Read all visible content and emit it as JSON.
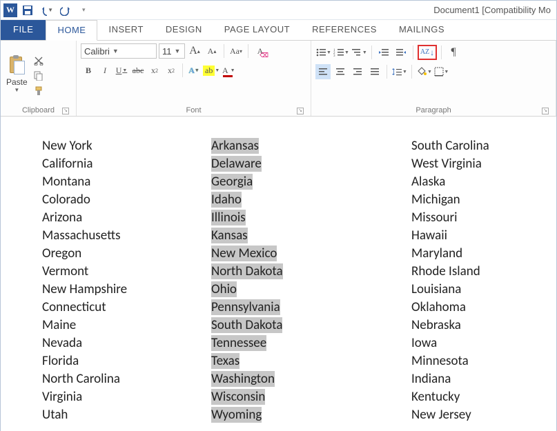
{
  "title": "Document1 [Compatibility Mo",
  "app_icon_letter": "W",
  "qat": {
    "save": "save-icon",
    "undo": "undo-icon",
    "redo": "redo-icon"
  },
  "tabs": {
    "file": "FILE",
    "home": "HOME",
    "insert": "INSERT",
    "design": "DESIGN",
    "page_layout": "PAGE LAYOUT",
    "references": "REFERENCES",
    "mailings": "MAILINGS"
  },
  "clipboard": {
    "label": "Clipboard",
    "paste": "Paste"
  },
  "font": {
    "label": "Font",
    "name": "Calibri",
    "size": "11",
    "bold": "B",
    "italic": "I",
    "underline": "U",
    "strike": "abc",
    "sub": "x",
    "sup": "x",
    "caseA": "A",
    "caseAa": "Aa",
    "clear": "A",
    "grow": "A",
    "shrink": "A",
    "highlight": "ab",
    "color": "A"
  },
  "paragraph": {
    "label": "Paragraph",
    "sortA": "A",
    "sortZ": "Z",
    "pilcrow": "¶"
  },
  "doc": {
    "col1": [
      "New York",
      "California",
      "Montana",
      "Colorado",
      "Arizona",
      "Massachusetts",
      "Oregon",
      "Vermont",
      "New Hampshire",
      "Connecticut",
      "Maine",
      "Nevada",
      "Florida",
      "North Carolina",
      "Virginia",
      "Utah"
    ],
    "col2": [
      "Arkansas",
      "Delaware",
      "Georgia",
      "Idaho",
      "Illinois",
      "Kansas",
      "New Mexico",
      "North Dakota",
      "Ohio",
      "Pennsylvania",
      "South Dakota",
      "Tennessee",
      "Texas",
      "Washington",
      "Wisconsin",
      "Wyoming"
    ],
    "col3": [
      "South Carolina",
      "West Virginia",
      "Alaska",
      "Michigan",
      "Missouri",
      "Hawaii",
      "Maryland",
      "Rhode Island",
      "Louisiana",
      "Oklahoma",
      "Nebraska",
      "Iowa",
      "Minnesota",
      "Indiana",
      "Kentucky",
      "New Jersey"
    ]
  }
}
